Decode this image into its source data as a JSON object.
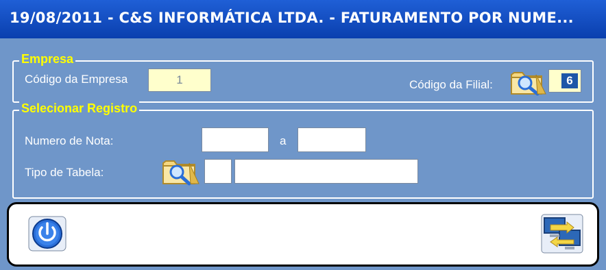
{
  "window": {
    "title": "19/08/2011  -  C&S INFORMÁTICA LTDA.  -  FATURAMENTO POR NUME..."
  },
  "empresa": {
    "legend": "Empresa",
    "codigo_empresa_label": "Código da Empresa",
    "codigo_empresa_value": "1",
    "codigo_filial_label": "Código da Filial:",
    "codigo_filial_value": "6"
  },
  "registro": {
    "legend": "Selecionar Registro",
    "numero_nota_label": "Numero de Nota:",
    "numero_nota_from": "",
    "separator": "a",
    "numero_nota_to": "",
    "tipo_tabela_label": "Tipo de Tabela:",
    "tipo_tabela_code": "",
    "tipo_tabela_desc": ""
  },
  "icons": {
    "filial_search": "folder-search-icon",
    "tabela_search": "folder-search-icon",
    "exit": "power-icon",
    "transfer": "monitors-transfer-icon"
  },
  "colors": {
    "background": "#6f96c9",
    "titlebar": "#0a3fae",
    "legend_text": "#ffff00",
    "readonly_field": "#ffffcc"
  }
}
